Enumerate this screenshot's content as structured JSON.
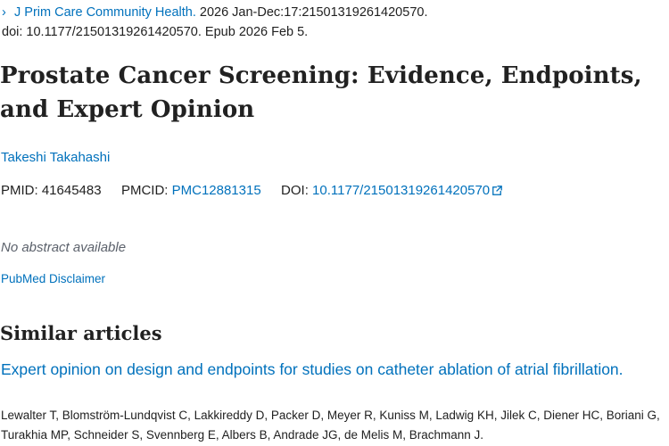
{
  "citation": {
    "journal": "J Prim Care Community Health.",
    "details": " 2026 Jan-Dec:17:21501319261420570.",
    "line2": "doi: 10.1177/21501319261420570. Epub 2026 Feb 5."
  },
  "article": {
    "title": "Prostate Cancer Screening: Evidence, Endpoints, and Expert Opinion",
    "author": "Takeshi Takahashi"
  },
  "identifiers": {
    "pmid_label": "PMID:",
    "pmid": "41645483",
    "pmcid_label": "PMCID:",
    "pmcid": "PMC12881315",
    "doi_label": "DOI:",
    "doi": "10.1177/21501319261420570"
  },
  "abstract_status": "No abstract available",
  "disclaimer_link": "PubMed Disclaimer",
  "similar": {
    "heading": "Similar articles",
    "items": [
      {
        "title": "Expert opinion on design and endpoints for studies on catheter ablation of atrial fibrillation.",
        "authors": "Lewalter T, Blomström-Lundqvist C, Lakkireddy D, Packer D, Meyer R, Kuniss M, Ladwig KH, Jilek C, Diener HC, Boriani G, Turakhia MP, Schneider S, Svennberg E, Albers B, Andrade JG, de Melis M, Brachmann J."
      }
    ]
  },
  "icons": {
    "chevron": "chevron-right-icon",
    "external_link": "external-link-icon"
  },
  "colors": {
    "link": "#0071bc",
    "text": "#212121",
    "muted": "#5b616b"
  }
}
